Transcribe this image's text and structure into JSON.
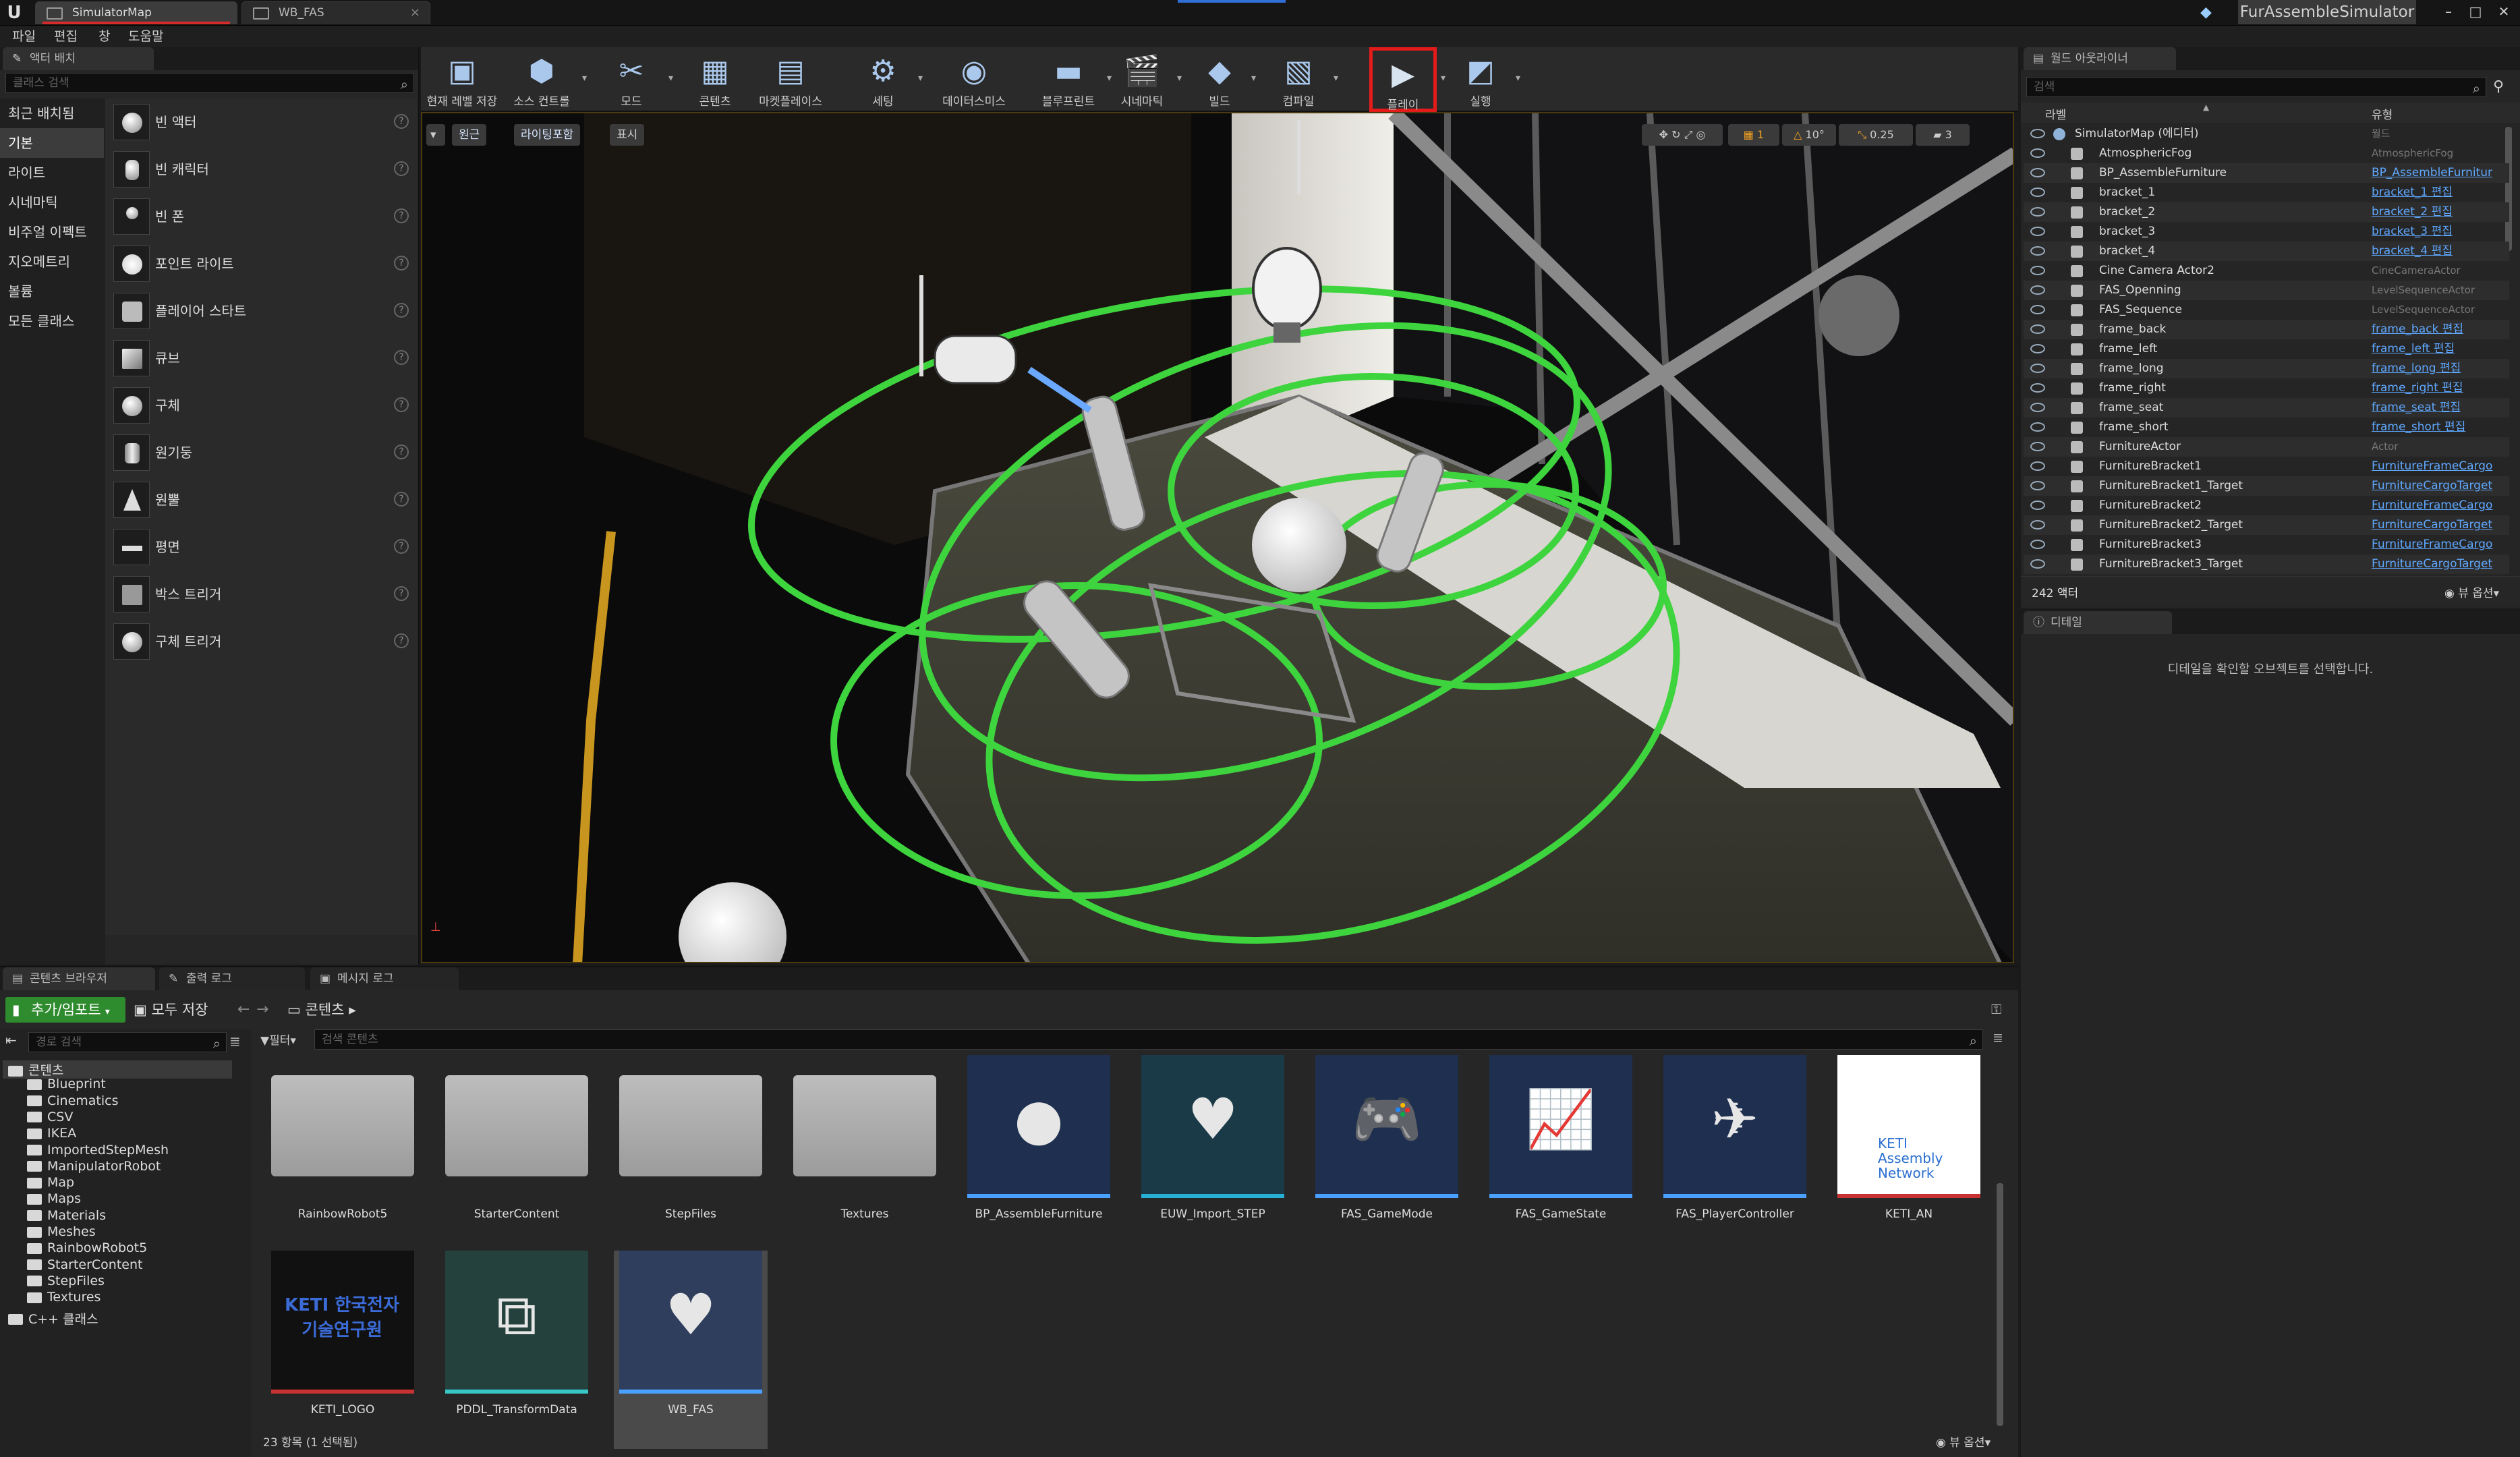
{
  "titlebar": {
    "tabs": [
      {
        "label": "SimulatorMap"
      },
      {
        "label": "WB_FAS"
      }
    ],
    "app_title": "FurAssembleSimulator"
  },
  "menu": [
    "파일",
    "편집",
    "창",
    "도움말"
  ],
  "place_actors": {
    "tab": "액터 배치",
    "search_placeholder": "클래스 검색",
    "categories": [
      "최근 배치됨",
      "기본",
      "라이트",
      "시네마틱",
      "비주얼 이펙트",
      "지오메트리",
      "볼륨",
      "모든 클래스"
    ],
    "selected_category": "기본",
    "items": [
      "빈 액터",
      "빈 캐릭터",
      "빈 폰",
      "포인트 라이트",
      "플레이어 스타트",
      "큐브",
      "구체",
      "원기둥",
      "원뿔",
      "평면",
      "박스 트리거",
      "구체 트리거"
    ]
  },
  "toolbar": {
    "buttons": [
      {
        "label": "현재 레벨 저장",
        "icon": "save-icon"
      },
      {
        "label": "소스 컨트롤",
        "icon": "source-control-icon"
      },
      {
        "label": "모드",
        "icon": "modes-icon"
      },
      {
        "label": "콘텐츠",
        "icon": "content-icon"
      },
      {
        "label": "마켓플레이스",
        "icon": "marketplace-icon"
      },
      {
        "label": "세팅",
        "icon": "settings-icon"
      },
      {
        "label": "데이터스미스",
        "icon": "datasmith-icon"
      },
      {
        "label": "블루프린트",
        "icon": "blueprint-icon"
      },
      {
        "label": "시네마틱",
        "icon": "cinematics-icon"
      },
      {
        "label": "빌드",
        "icon": "build-icon"
      },
      {
        "label": "컴파일",
        "icon": "compile-icon"
      },
      {
        "label": "플레이",
        "icon": "play-icon"
      },
      {
        "label": "실행",
        "icon": "launch-icon"
      }
    ]
  },
  "viewport": {
    "left_buttons": [
      "원근",
      "라이팅포함",
      "표시"
    ],
    "right_values": [
      "10°",
      "0.25",
      "3"
    ]
  },
  "outliner": {
    "tab": "월드 아웃라이너",
    "search_placeholder": "검색",
    "col_label": "라벨",
    "col_type": "유형",
    "root": {
      "name": "SimulatorMap (에디터)",
      "type": "월드"
    },
    "rows": [
      {
        "name": "AtmosphericFog",
        "type": "AtmosphericFog",
        "link": false
      },
      {
        "name": "BP_AssembleFurniture",
        "type": "BP_AssembleFurnitur",
        "link": true
      },
      {
        "name": "bracket_1",
        "type": "bracket_1 편집",
        "link": true
      },
      {
        "name": "bracket_2",
        "type": "bracket_2 편집",
        "link": true
      },
      {
        "name": "bracket_3",
        "type": "bracket_3 편집",
        "link": true
      },
      {
        "name": "bracket_4",
        "type": "bracket_4 편집",
        "link": true
      },
      {
        "name": "Cine Camera Actor2",
        "type": "CineCameraActor",
        "link": false
      },
      {
        "name": "FAS_Openning",
        "type": "LevelSequenceActor",
        "link": false
      },
      {
        "name": "FAS_Sequence",
        "type": "LevelSequenceActor",
        "link": false
      },
      {
        "name": "frame_back",
        "type": "frame_back 편집",
        "link": true
      },
      {
        "name": "frame_left",
        "type": "frame_left 편집",
        "link": true
      },
      {
        "name": "frame_long",
        "type": "frame_long 편집",
        "link": true
      },
      {
        "name": "frame_right",
        "type": "frame_right 편집",
        "link": true
      },
      {
        "name": "frame_seat",
        "type": "frame_seat 편집",
        "link": true
      },
      {
        "name": "frame_short",
        "type": "frame_short 편집",
        "link": true
      },
      {
        "name": "FurnitureActor",
        "type": "Actor",
        "link": false
      },
      {
        "name": "FurnitureBracket1",
        "type": "FurnitureFrameCargo",
        "link": true
      },
      {
        "name": "FurnitureBracket1_Target",
        "type": "FurnitureCargoTarget",
        "link": true
      },
      {
        "name": "FurnitureBracket2",
        "type": "FurnitureFrameCargo",
        "link": true
      },
      {
        "name": "FurnitureBracket2_Target",
        "type": "FurnitureCargoTarget",
        "link": true
      },
      {
        "name": "FurnitureBracket3",
        "type": "FurnitureFrameCargo",
        "link": true
      },
      {
        "name": "FurnitureBracket3_Target",
        "type": "FurnitureCargoTarget",
        "link": true
      }
    ],
    "actor_count": "242 액터",
    "view_options": "뷰 옵션"
  },
  "details": {
    "tab": "디테일",
    "empty_message": "디테일을 확인할 오브젝트를 선택합니다."
  },
  "content_browser": {
    "tabs": [
      "콘텐츠 브라우저",
      "출력 로그",
      "메시지 로그"
    ],
    "add_import": "추가/임포트",
    "save_all": "모두 저장",
    "path_root": "콘텐츠",
    "tree_search_placeholder": "경로 검색",
    "filter_label": "필터",
    "search_placeholder": "검색 콘텐츠",
    "tree": [
      "콘텐츠",
      "Blueprint",
      "Cinematics",
      "CSV",
      "IKEA",
      "ImportedStepMesh",
      "ManipulatorRobot",
      "Map",
      "Maps",
      "Materials",
      "Meshes",
      "RainbowRobot5",
      "StarterContent",
      "StepFiles",
      "Textures",
      "C++ 클래스"
    ],
    "assets": [
      {
        "name": "RainbowRobot5",
        "kind": "folder"
      },
      {
        "name": "StarterContent",
        "kind": "folder"
      },
      {
        "name": "StepFiles",
        "kind": "folder"
      },
      {
        "name": "Textures",
        "kind": "folder"
      },
      {
        "name": "BP_AssembleFurniture",
        "kind": "blueprint"
      },
      {
        "name": "EUW_Import_STEP",
        "kind": "widget"
      },
      {
        "name": "FAS_GameMode",
        "kind": "blueprint"
      },
      {
        "name": "FAS_GameState",
        "kind": "blueprint"
      },
      {
        "name": "FAS_PlayerController",
        "kind": "blueprint"
      },
      {
        "name": "KETI_AN",
        "kind": "texture"
      },
      {
        "name": "KETI_LOGO",
        "kind": "texture"
      },
      {
        "name": "PDDL_TransformData",
        "kind": "data"
      },
      {
        "name": "WB_FAS",
        "kind": "widget"
      }
    ],
    "keti_an_text": "KETI Assembly Network",
    "keti_logo_text": "KETI 한국전자기술연구원",
    "status": "23 항목 (1 선택됨)",
    "view_options": "뷰 옵션"
  }
}
